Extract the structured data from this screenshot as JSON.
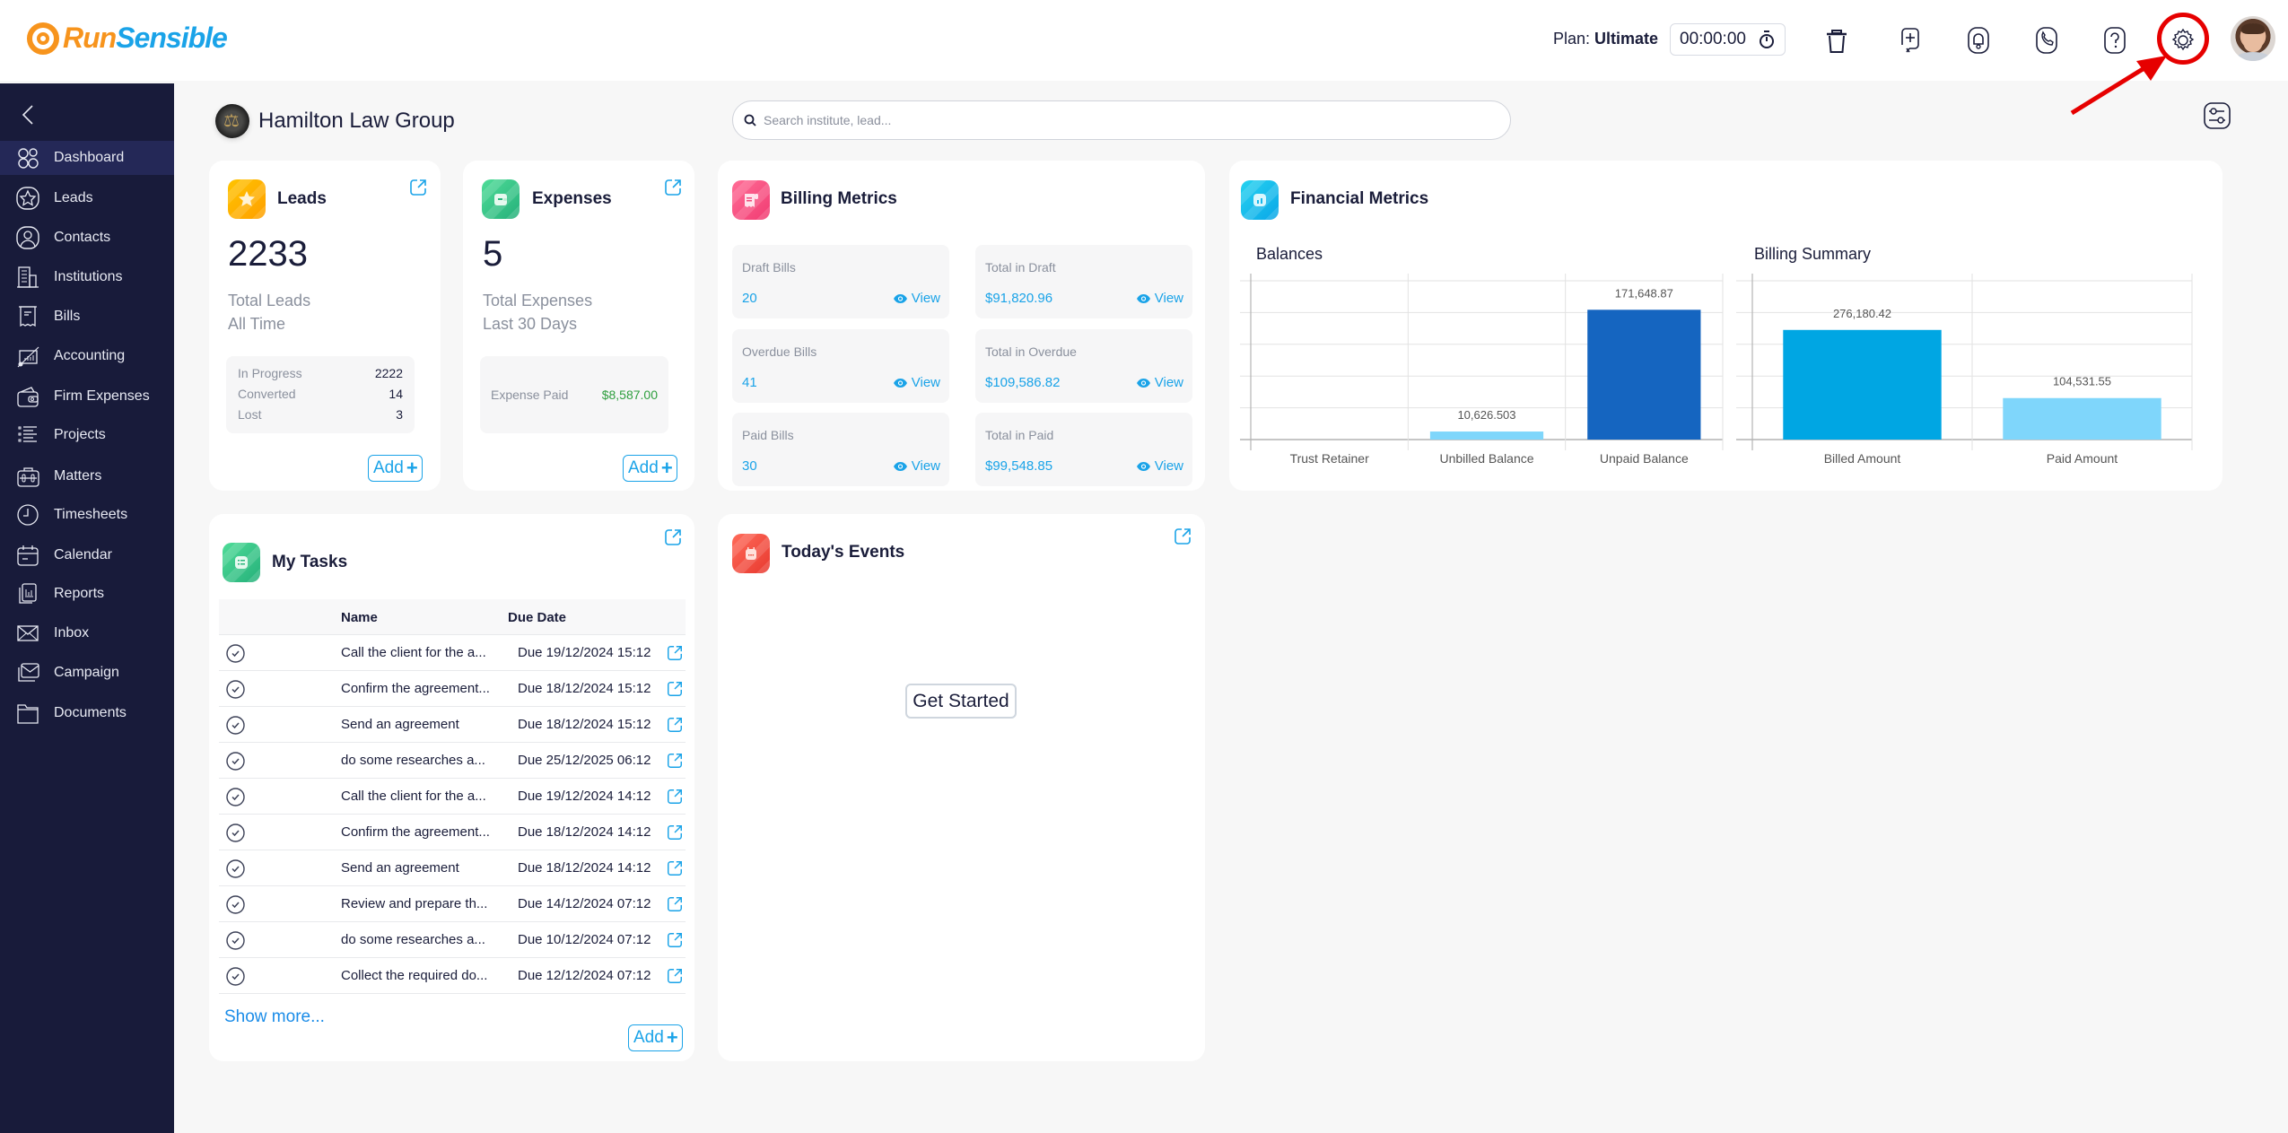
{
  "app": {
    "logo_part1": "Run",
    "logo_part2": "Sensible",
    "plan_label": "Plan:",
    "plan_value": "Ultimate",
    "timer": "00:00:00"
  },
  "topbar_icons": [
    "timer-icon",
    "trash-icon",
    "add-task-icon",
    "notifications-icon",
    "phone-icon",
    "help-icon",
    "settings-icon",
    "user-avatar"
  ],
  "sidebar": {
    "items": [
      {
        "label": "Dashboard",
        "icon": "dashboard-icon",
        "active": true
      },
      {
        "label": "Leads",
        "icon": "star-icon"
      },
      {
        "label": "Contacts",
        "icon": "contact-icon"
      },
      {
        "label": "Institutions",
        "icon": "building-icon"
      },
      {
        "label": "Bills",
        "icon": "receipt-icon"
      },
      {
        "label": "Accounting",
        "icon": "accounting-icon"
      },
      {
        "label": "Firm Expenses",
        "icon": "wallet-icon"
      },
      {
        "label": "Projects",
        "icon": "list-icon"
      },
      {
        "label": "Matters",
        "icon": "briefcase-icon"
      },
      {
        "label": "Timesheets",
        "icon": "clock-icon"
      },
      {
        "label": "Calendar",
        "icon": "calendar-icon"
      },
      {
        "label": "Reports",
        "icon": "reports-icon"
      },
      {
        "label": "Inbox",
        "icon": "mail-icon"
      },
      {
        "label": "Campaign",
        "icon": "campaign-icon"
      },
      {
        "label": "Documents",
        "icon": "folder-icon"
      }
    ]
  },
  "header": {
    "firm_name": "Hamilton Law Group",
    "search_placeholder": "Search institute, lead..."
  },
  "leads": {
    "title": "Leads",
    "total": "2233",
    "label1": "Total Leads",
    "label2": "All Time",
    "stats": [
      {
        "label": "In Progress",
        "value": "2222"
      },
      {
        "label": "Converted",
        "value": "14"
      },
      {
        "label": "Lost",
        "value": "3"
      }
    ],
    "add_label": "Add"
  },
  "expenses": {
    "title": "Expenses",
    "total": "5",
    "label1": "Total Expenses",
    "label2": "Last 30 Days",
    "paid_label": "Expense Paid",
    "paid_value": "$8,587.00",
    "add_label": "Add"
  },
  "billing_metrics": {
    "title": "Billing Metrics",
    "view_label": "View",
    "tiles": [
      {
        "label": "Draft Bills",
        "value": "20"
      },
      {
        "label": "Total in Draft",
        "value": "$91,820.96"
      },
      {
        "label": "Overdue Bills",
        "value": "41"
      },
      {
        "label": "Total in Overdue",
        "value": "$109,586.82"
      },
      {
        "label": "Paid Bills",
        "value": "30"
      },
      {
        "label": "Total in Paid",
        "value": "$99,548.85"
      }
    ]
  },
  "financial_metrics": {
    "title": "Financial Metrics"
  },
  "chart_data": [
    {
      "type": "bar",
      "title": "Balances",
      "categories": [
        "Trust Retainer",
        "Unbilled Balance",
        "Unpaid Balance"
      ],
      "values": [
        0,
        10626.503,
        171648.87
      ],
      "value_labels": [
        "",
        "10,626.503",
        "171,648.87"
      ],
      "colors": [
        "#7fd6fb",
        "#7fd6fb",
        "#1565c0"
      ],
      "xlabel": "",
      "ylabel": "",
      "ylim": [
        0,
        210000
      ],
      "grid": true
    },
    {
      "type": "bar",
      "title": "Billing Summary",
      "categories": [
        "Billed Amount",
        "Paid Amount"
      ],
      "values": [
        276180.42,
        104531.55
      ],
      "value_labels": [
        "276,180.42",
        "104,531.55"
      ],
      "colors": [
        "#00a6e3",
        "#7fd6fb"
      ],
      "xlabel": "",
      "ylabel": "",
      "ylim": [
        0,
        400000
      ],
      "grid": true
    }
  ],
  "tasks": {
    "title": "My Tasks",
    "columns": [
      "Name",
      "Due Date"
    ],
    "rows": [
      {
        "name": "Call the client for the a...",
        "due": "Due  19/12/2024 15:12"
      },
      {
        "name": "Confirm the agreement...",
        "due": "Due  18/12/2024 15:12"
      },
      {
        "name": "Send an agreement",
        "due": "Due  18/12/2024 15:12"
      },
      {
        "name": "do some researches a...",
        "due": "Due  25/12/2025 06:12"
      },
      {
        "name": "Call the client for the a...",
        "due": "Due  19/12/2024 14:12"
      },
      {
        "name": "Confirm the agreement...",
        "due": "Due  18/12/2024 14:12"
      },
      {
        "name": "Send an agreement",
        "due": "Due  18/12/2024 14:12"
      },
      {
        "name": "Review and prepare th...",
        "due": "Due  14/12/2024 07:12"
      },
      {
        "name": "do some researches a...",
        "due": "Due  10/12/2024 07:12"
      },
      {
        "name": "Collect the required do...",
        "due": "Due  12/12/2024 07:12"
      }
    ],
    "show_more": "Show more...",
    "add_label": "Add"
  },
  "events": {
    "title": "Today's Events",
    "get_started": "Get Started"
  },
  "colors": {
    "accent": "#1aa3e8",
    "sidebar_bg": "#181b3a",
    "sidebar_active": "#242857",
    "highlight": "#e60000",
    "green_value": "#2e9e3e"
  }
}
